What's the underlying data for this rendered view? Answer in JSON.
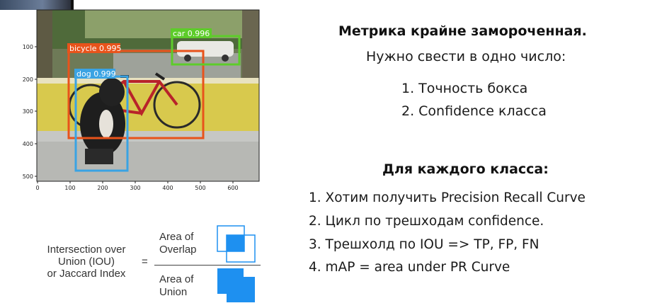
{
  "figure": {
    "y_ticks": [
      "100",
      "200",
      "300",
      "400",
      "500"
    ],
    "x_ticks": [
      "0",
      "100",
      "200",
      "300",
      "400",
      "500",
      "600"
    ],
    "detections": [
      {
        "label": "bicycle 0.995",
        "color": "#e8531b"
      },
      {
        "label": "dog 0.999",
        "color": "#3aa3e3"
      },
      {
        "label": "car 0.996",
        "color": "#5dcc2a"
      }
    ]
  },
  "iou": {
    "term": "Intersection over\nUnion (IOU)\nor Jaccard Index",
    "equals": "=",
    "numerator": "Area of\nOverlap",
    "denominator": "Area of\nUnion",
    "color": "#1e90f0"
  },
  "slide": {
    "heading1": "Метрика крайне замороченная.",
    "subline": "Нужно свести в одно число:",
    "list1": [
      "1. Точность бокса",
      "2. Confidence класса"
    ],
    "heading2": "Для каждого класса:",
    "list2": [
      "1. Хотим получить Precision Recall Curve",
      "2. Цикл по трешходам confidence.",
      "3. Трешхолд по IOU => TP, FP, FN",
      "4. mAP = area under PR Curve"
    ]
  }
}
